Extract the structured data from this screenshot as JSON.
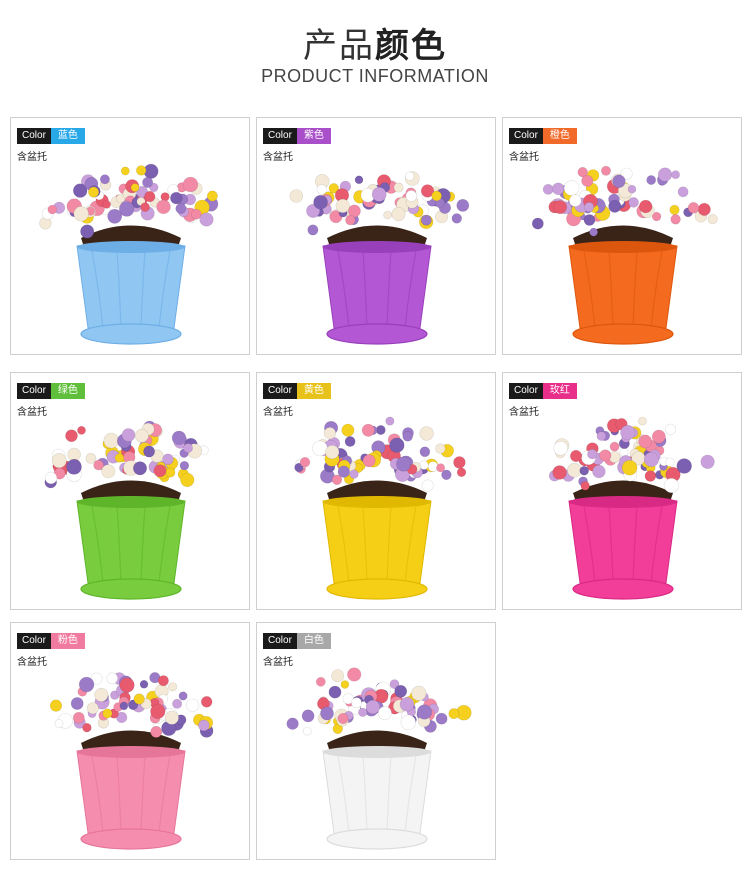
{
  "header": {
    "title_light": "产品",
    "title_bold": "颜色",
    "subtitle": "PRODUCT INFORMATION"
  },
  "products": [
    {
      "tag_en": "Color",
      "tag_cn": "蓝色",
      "tray": "含盆托",
      "tag_color": "#29a8e8",
      "pot_color": "#90c6f2",
      "pot_dark": "#6eaee6"
    },
    {
      "tag_en": "Color",
      "tag_cn": "紫色",
      "tray": "含盆托",
      "tag_color": "#a94fc9",
      "pot_color": "#b457d4",
      "pot_dark": "#9840bb"
    },
    {
      "tag_en": "Color",
      "tag_cn": "橙色",
      "tray": "含盆托",
      "tag_color": "#f26a2a",
      "pot_color": "#f46b1f",
      "pot_dark": "#dc560e"
    },
    {
      "tag_en": "Color",
      "tag_cn": "绿色",
      "tray": "含盆托",
      "tag_color": "#5fbf3a",
      "pot_color": "#78cc3e",
      "pot_dark": "#5fb52a"
    },
    {
      "tag_en": "Color",
      "tag_cn": "黄色",
      "tray": "含盆托",
      "tag_color": "#e7c21a",
      "pot_color": "#f5cf16",
      "pot_dark": "#e0b800"
    },
    {
      "tag_en": "Color",
      "tag_cn": "玫红",
      "tray": "含盆托",
      "tag_color": "#e8308a",
      "pot_color": "#f23d99",
      "pot_dark": "#d82a84"
    },
    {
      "tag_en": "Color",
      "tag_cn": "粉色",
      "tray": "含盆托",
      "tag_color": "#f07aa0",
      "pot_color": "#f58eae",
      "pot_dark": "#e6759a"
    },
    {
      "tag_en": "Color",
      "tag_cn": "白色",
      "tray": "含盆托",
      "tag_color": "#a8a8a8",
      "pot_color": "#f4f4f4",
      "pot_dark": "#dcdcdc"
    }
  ],
  "flower_colors": [
    "#f5d01e",
    "#9b7ac8",
    "#f28aa6",
    "#f3e9d6",
    "#7b5fb0",
    "#e85a6e",
    "#ffffff",
    "#c9a0dc"
  ]
}
